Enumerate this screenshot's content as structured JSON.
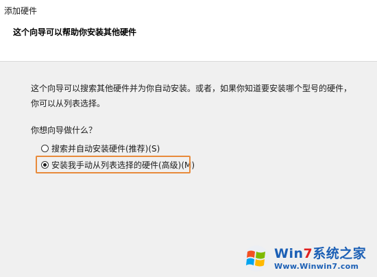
{
  "window": {
    "title": "添加硬件"
  },
  "header": {
    "heading": "这个向导可以帮助你安装其他硬件"
  },
  "content": {
    "description": "这个向导可以搜索其他硬件并为你自动安装。或者，如果你知道要安装哪个型号的硬件，你可以从列表选择。",
    "question": "你想向导做什么？",
    "options": [
      {
        "label": "搜索并自动安装硬件(推荐)(S)",
        "checked": false
      },
      {
        "label": "安装我手动从列表选择的硬件(高级)(M)",
        "checked": true
      }
    ]
  },
  "watermark": {
    "brand_prefix": "Win",
    "brand_digit": "7",
    "brand_suffix": "系统之家",
    "url": "Www.Winwin7.com",
    "flag_icon": "windows-flag-icon"
  },
  "colors": {
    "highlight_border": "#e88a3a",
    "header_bg": "#ffffff",
    "body_bg": "#f0f0f0",
    "watermark_blue": "#1b5fb5",
    "watermark_red": "#e02020"
  }
}
